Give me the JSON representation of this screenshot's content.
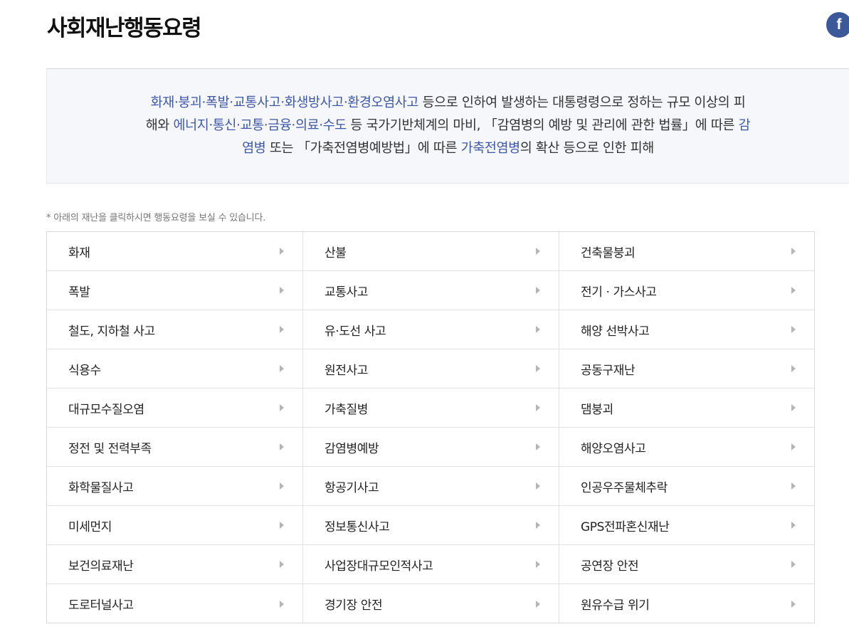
{
  "page": {
    "title": "사회재난행동요령"
  },
  "share": {
    "facebook_label": "f"
  },
  "definition": {
    "segments": [
      {
        "text": "화재·붕괴·폭발·교통사고·화생방사고·환경오염사고",
        "highlight": true
      },
      {
        "text": " 등으로 인하여 발생하는 대통령령으로 정하는 규모 이상의 피해와 ",
        "highlight": false
      },
      {
        "text": "에너지·통신·교통·금융·의료·수도",
        "highlight": true
      },
      {
        "text": " 등 국가기반체계의 마비, 「감염병의 예방 및 관리에 관한 법률」에 따른 ",
        "highlight": false
      },
      {
        "text": "감염병",
        "highlight": true
      },
      {
        "text": " 또는 「가축전염병예방법」에 따른 ",
        "highlight": false
      },
      {
        "text": "가축전염병",
        "highlight": true
      },
      {
        "text": "의 확산 등으로 인한 피해",
        "highlight": false
      }
    ]
  },
  "note": "* 아래의 재난을 클릭하시면 행동요령을 보실 수 있습니다.",
  "disasters": [
    "화재",
    "산불",
    "건축물붕괴",
    "폭발",
    "교통사고",
    "전기 · 가스사고",
    "철도, 지하철 사고",
    "유·도선 사고",
    "해양 선박사고",
    "식용수",
    "원전사고",
    "공동구재난",
    "대규모수질오염",
    "가축질병",
    "댐붕괴",
    "정전 및 전력부족",
    "감염병예방",
    "해양오염사고",
    "화학물질사고",
    "항공기사고",
    "인공우주물체추락",
    "미세먼지",
    "정보통신사고",
    "GPS전파혼신재난",
    "보건의료재난",
    "사업장대규모인적사고",
    "공연장 안전",
    "도로터널사고",
    "경기장 안전",
    "원유수급 위기"
  ],
  "colors": {
    "highlight": "#3d58a8",
    "facebook": "#3b5998",
    "box_bg": "#f6f7fa"
  },
  "icons": {
    "facebook": "facebook-icon",
    "row_arrow": "chevron-right-icon"
  }
}
